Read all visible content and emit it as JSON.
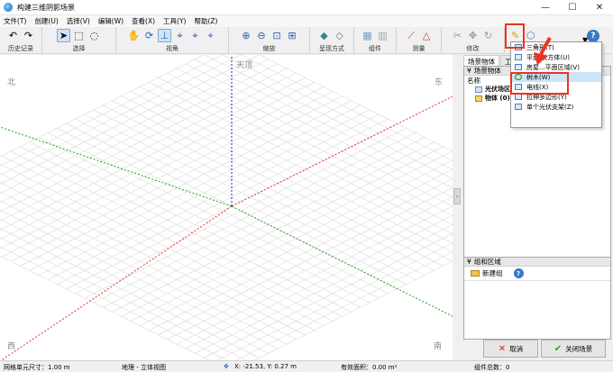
{
  "window": {
    "title": "构建三维阴影场景",
    "minimize": "—",
    "maximize": "☐",
    "close": "✕"
  },
  "menu": [
    "文件(T)",
    "创建(U)",
    "选择(V)",
    "编辑(W)",
    "查看(X)",
    "工具(Y)",
    "帮助(Z)"
  ],
  "toolbar": {
    "groups": [
      {
        "label": "历史记录",
        "icons": [
          "undo-icon",
          "redo-icon"
        ]
      },
      {
        "label": "选择",
        "icons": [
          "pointer-icon",
          "rect-select-icon",
          "lasso-select-icon"
        ]
      },
      {
        "label": "视角",
        "icons": [
          "pan-hand-icon",
          "orbit-icon",
          "axes-icon",
          "view-front-icon",
          "view-side-icon",
          "view-top-icon"
        ]
      },
      {
        "label": "缩放",
        "icons": [
          "zoom-in-icon",
          "zoom-out-icon",
          "zoom-window-icon",
          "zoom-extents-icon"
        ]
      },
      {
        "label": "呈现方式",
        "icons": [
          "render-solid-icon",
          "render-wire-icon"
        ]
      },
      {
        "label": "组件",
        "icons": [
          "component-a-icon",
          "component-b-icon"
        ]
      },
      {
        "label": "测量",
        "icons": [
          "measure-line-icon",
          "measure-angle-icon"
        ]
      },
      {
        "label": "修改",
        "icons": [
          "cut-icon",
          "move-icon",
          "rotate-icon"
        ]
      },
      {
        "label": "",
        "icons": [
          "pencil-icon",
          "shape-icon"
        ]
      }
    ],
    "help_glyph": "?"
  },
  "viewport": {
    "compass": {
      "top": "天顶",
      "ne": "东",
      "nw": "北",
      "sw": "西",
      "se": "南"
    },
    "colors": {
      "x_axis": "#e33333",
      "y_axis": "#22a022",
      "z_axis": "#2222cc",
      "grid": "#d9d9d9"
    }
  },
  "splitter_glyph": "›",
  "panel": {
    "tabs": [
      "场景物体",
      "工具"
    ],
    "scene_section": "场景物体",
    "col_name": "名称",
    "items": [
      "光伏场区",
      "物体 (0)"
    ],
    "group_section": "组和区域",
    "new_group": "新建组",
    "help_glyph": "?",
    "cancel": "取消",
    "close_scene": "关闭场景"
  },
  "dropdown": [
    {
      "label": "三角形(T)",
      "icon": "triangle-icon",
      "highlighted": false
    },
    {
      "label": "平面/长方体(U)",
      "icon": "plane-box-icon",
      "highlighted": false
    },
    {
      "label": "房屋...平面区域(V)",
      "icon": "house-icon",
      "highlighted": false
    },
    {
      "label": "树木(W)",
      "icon": "tree-icon",
      "highlighted": true
    },
    {
      "label": "电线(X)",
      "icon": "wire-icon",
      "highlighted": false
    },
    {
      "label": "拉伸多边形(Y)",
      "icon": "extrude-polygon-icon",
      "highlighted": false
    },
    {
      "label": "单个光伏支架(Z)",
      "icon": "pv-rack-icon",
      "highlighted": false
    }
  ],
  "status": {
    "grid": "网格单元尺寸：1.00 m",
    "view": "地理 - 立体视图",
    "coords": "X: -21.53, Y: 0.27 m",
    "area": "有效面积：0.00 m²",
    "components": "组件总数：0"
  }
}
